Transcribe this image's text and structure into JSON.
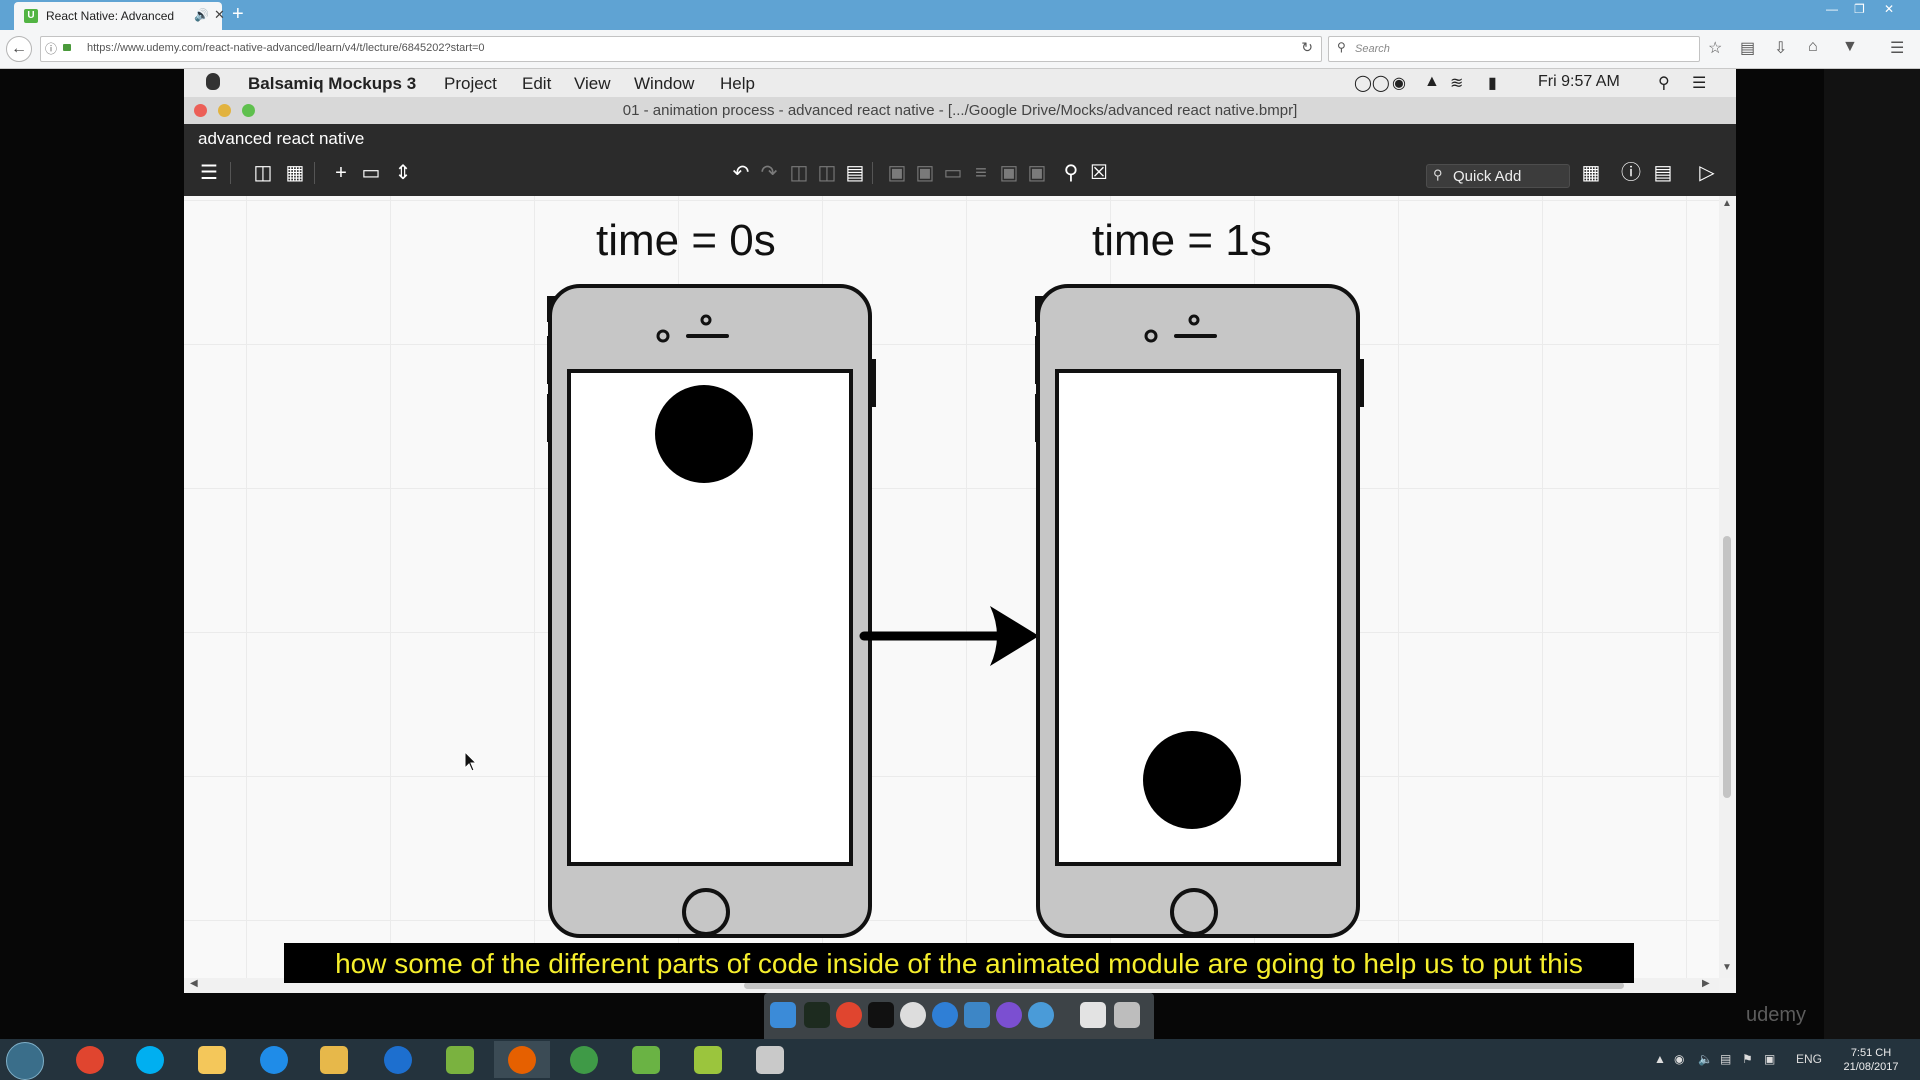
{
  "browser": {
    "tab_title": "React Native: Advanced",
    "url": "https://www.udemy.com/react-native-advanced/learn/v4/t/lecture/6845202?start=0",
    "search_placeholder": "Search"
  },
  "mac_menu": {
    "app": "Balsamiq Mockups 3",
    "items": [
      "Project",
      "Edit",
      "View",
      "Window",
      "Help"
    ],
    "clock": "Fri 9:57 AM"
  },
  "balsamiq": {
    "window_title": "01 - animation process - advanced react native - [.../Google Drive/Mocks/advanced react native.bmpr]",
    "project_name": "advanced react native",
    "quick_add": "Quick Add"
  },
  "mockup": {
    "left_label": "time = 0s",
    "right_label": "time = 1s"
  },
  "subtitle": "how some of the different parts of code inside of the animated module are going to help us to put this",
  "video_brand": "udemy",
  "taskbar": {
    "language": "ENG",
    "time": "7:51 CH",
    "date": "21/08/2017"
  },
  "colors": {
    "tab_bar": "#5fa3d3",
    "balsamiq_dark": "#2b2b2b",
    "subtitle_text": "#f5ee2c",
    "taskbar": "#24333d",
    "phone_body": "#c6c6c6"
  }
}
